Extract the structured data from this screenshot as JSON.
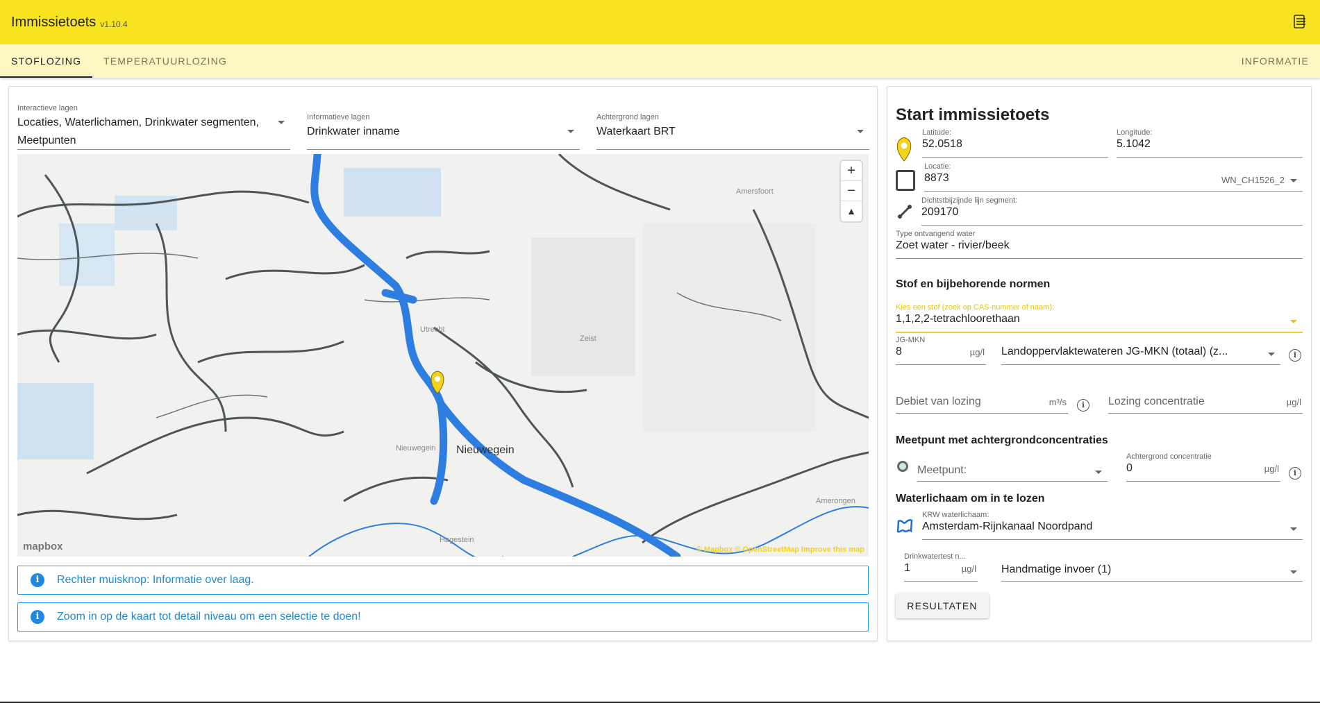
{
  "app": {
    "title": "Immissietoets",
    "version": "v1.10.4"
  },
  "tabs": [
    "STOFLOZING",
    "TEMPERATUURLOZING"
  ],
  "info_tab": "INFORMATIE",
  "layers": {
    "interactive": {
      "label": "Interactieve lagen",
      "value_line1": "Locaties, Waterlichamen, Drinkwater segmenten,",
      "value_line2": "Meetpunten"
    },
    "informative": {
      "label": "Informatieve lagen",
      "value": "Drinkwater inname"
    },
    "background": {
      "label": "Achtergrond lagen",
      "value": "Waterkaart BRT"
    }
  },
  "map": {
    "labels": [
      "Amersfoort",
      "Zeist",
      "Utrecht",
      "Nieuwegein",
      "Nieuwegein",
      "Hagestein",
      "Amerongen"
    ],
    "logo": "mapbox",
    "attribution": "© Mapbox © OpenStreetMap Improve this map",
    "zoom_in": "+",
    "zoom_out": "−",
    "compass": "▲"
  },
  "alerts": [
    "Rechter muisknop: Informatie over laag.",
    "Zoom in op de kaart tot detail niveau om een selectie te doen!"
  ],
  "form": {
    "title": "Start immissietoets",
    "latitude": {
      "label": "Latitude:",
      "value": "52.0518"
    },
    "longitude": {
      "label": "Longitude:",
      "value": "5.1042"
    },
    "locatie": {
      "label": "Locatie:",
      "value": "8873",
      "code": "WN_CH1526_2"
    },
    "segment": {
      "label": "Dichtstbijzijnde lijn segment:",
      "value": "209170"
    },
    "water_type": {
      "label": "Type ontvangend water",
      "value": "Zoet water - rivier/beek"
    },
    "stof_heading": "Stof en bijbehorende normen",
    "stof": {
      "label": "Kies een stof (zoek op CAS-nummer of naam):",
      "value": "1,1,2,2-tetrachloorethaan"
    },
    "jgmkn": {
      "label": "JG-MKN",
      "value": "8",
      "unit": "µg/l",
      "norm": "Landoppervlaktewateren JG-MKN (totaal) (z..."
    },
    "debiet": {
      "placeholder": "Debiet van lozing",
      "unit": "m³/s"
    },
    "lozing": {
      "placeholder": "Lozing concentratie",
      "unit": "µg/l"
    },
    "meetpunt_heading": "Meetpunt met achtergrondconcentraties",
    "meetpunt": {
      "placeholder": "Meetpunt:"
    },
    "achtergrond": {
      "label": "Achtergrond concentratie",
      "value": "0",
      "unit": "µg/l"
    },
    "water_heading": "Waterlichaam om in te lozen",
    "krw": {
      "label": "KRW waterlichaam:",
      "value": "Amsterdam-Rijnkanaal Noordpand"
    },
    "drinkwater": {
      "label": "Drinkwatertest n...",
      "value": "1",
      "unit": "µg/l",
      "mode": "Handmatige invoer (1)"
    },
    "button": "RESULTATEN"
  },
  "colors": {
    "appbar": "#f8e320",
    "tabbar": "#fbf6c2",
    "route": "#2d7ee0",
    "info": "#1e88e5"
  }
}
